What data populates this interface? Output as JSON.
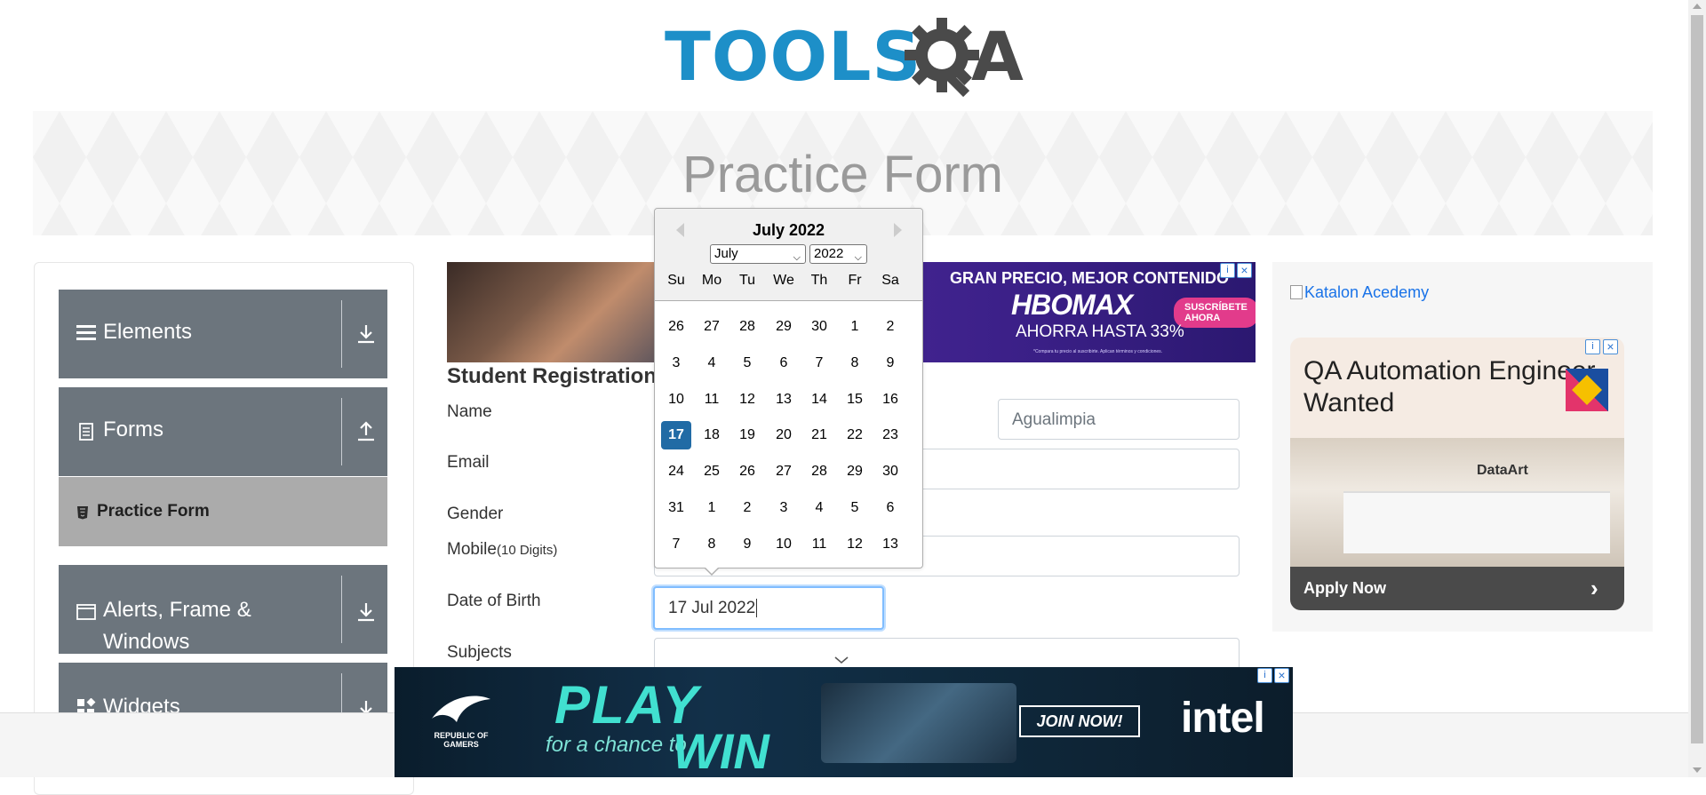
{
  "logo": {
    "text_main": "TOOLS",
    "text_q": "Q",
    "text_a": "A"
  },
  "banner": {
    "title": "Practice Form"
  },
  "sidebar": {
    "groups": [
      {
        "label": "Elements",
        "icon": "hamburger-icon",
        "toggle": "download-icon"
      },
      {
        "label": "Forms",
        "icon": "document-icon",
        "toggle": "upload-icon"
      },
      {
        "label": "Alerts, Frame & Windows",
        "icon": "window-icon",
        "toggle": "download-icon"
      },
      {
        "label": "Widgets",
        "icon": "widgets-icon",
        "toggle": "download-icon"
      }
    ],
    "active_item": {
      "label": "Practice Form",
      "icon": "html5-icon"
    }
  },
  "form": {
    "title": "Student Registration",
    "labels": {
      "name": "Name",
      "email": "Email",
      "gender": "Gender",
      "mobile": "Mobile",
      "mobile_hint": "(10 Digits)",
      "dob": "Date of Birth",
      "subjects": "Subjects"
    },
    "last_name_value": "Agualimpia",
    "dob_value": "17 Jul 2022"
  },
  "datepicker": {
    "header": "July 2022",
    "month_select": "July",
    "year_select": "2022",
    "weekdays": [
      "Su",
      "Mo",
      "Tu",
      "We",
      "Th",
      "Fr",
      "Sa"
    ],
    "weeks": [
      [
        "26",
        "27",
        "28",
        "29",
        "30",
        "1",
        "2"
      ],
      [
        "3",
        "4",
        "5",
        "6",
        "7",
        "8",
        "9"
      ],
      [
        "10",
        "11",
        "12",
        "13",
        "14",
        "15",
        "16"
      ],
      [
        "17",
        "18",
        "19",
        "20",
        "21",
        "22",
        "23"
      ],
      [
        "24",
        "25",
        "26",
        "27",
        "28",
        "29",
        "30"
      ],
      [
        "31",
        "1",
        "2",
        "3",
        "4",
        "5",
        "6"
      ],
      [
        "7",
        "8",
        "9",
        "10",
        "11",
        "12",
        "13"
      ]
    ],
    "selected_day": "17"
  },
  "top_ad": {
    "line1": "GRAN PRECIO, MEJOR CONTENIDO",
    "brand": "HBOMAX",
    "cta": "SUSCRÍBETE AHORA",
    "offer": "AHORRA HASTA 33%",
    "fineprint": "*Compara tu precio al suscribirte. Aplican términos y condiciones."
  },
  "right_ad": {
    "katalon_alt": "Katalon Acedemy",
    "card_title": "QA Automation Engineer Wanted",
    "company": "DataArt",
    "cta": "Apply Now"
  },
  "bottom_ad": {
    "rog_text": "REPUBLIC OF GAMERS",
    "play": "PLAY",
    "for_chance": "for a chance to",
    "win": "WIN",
    "join": "JOIN NOW!",
    "intel": "intel"
  },
  "colors": {
    "brand_blue": "#1d8fc8",
    "sidebar_group": "#6c757d",
    "active_item": "#ababab",
    "selected_day": "#216ba5"
  }
}
